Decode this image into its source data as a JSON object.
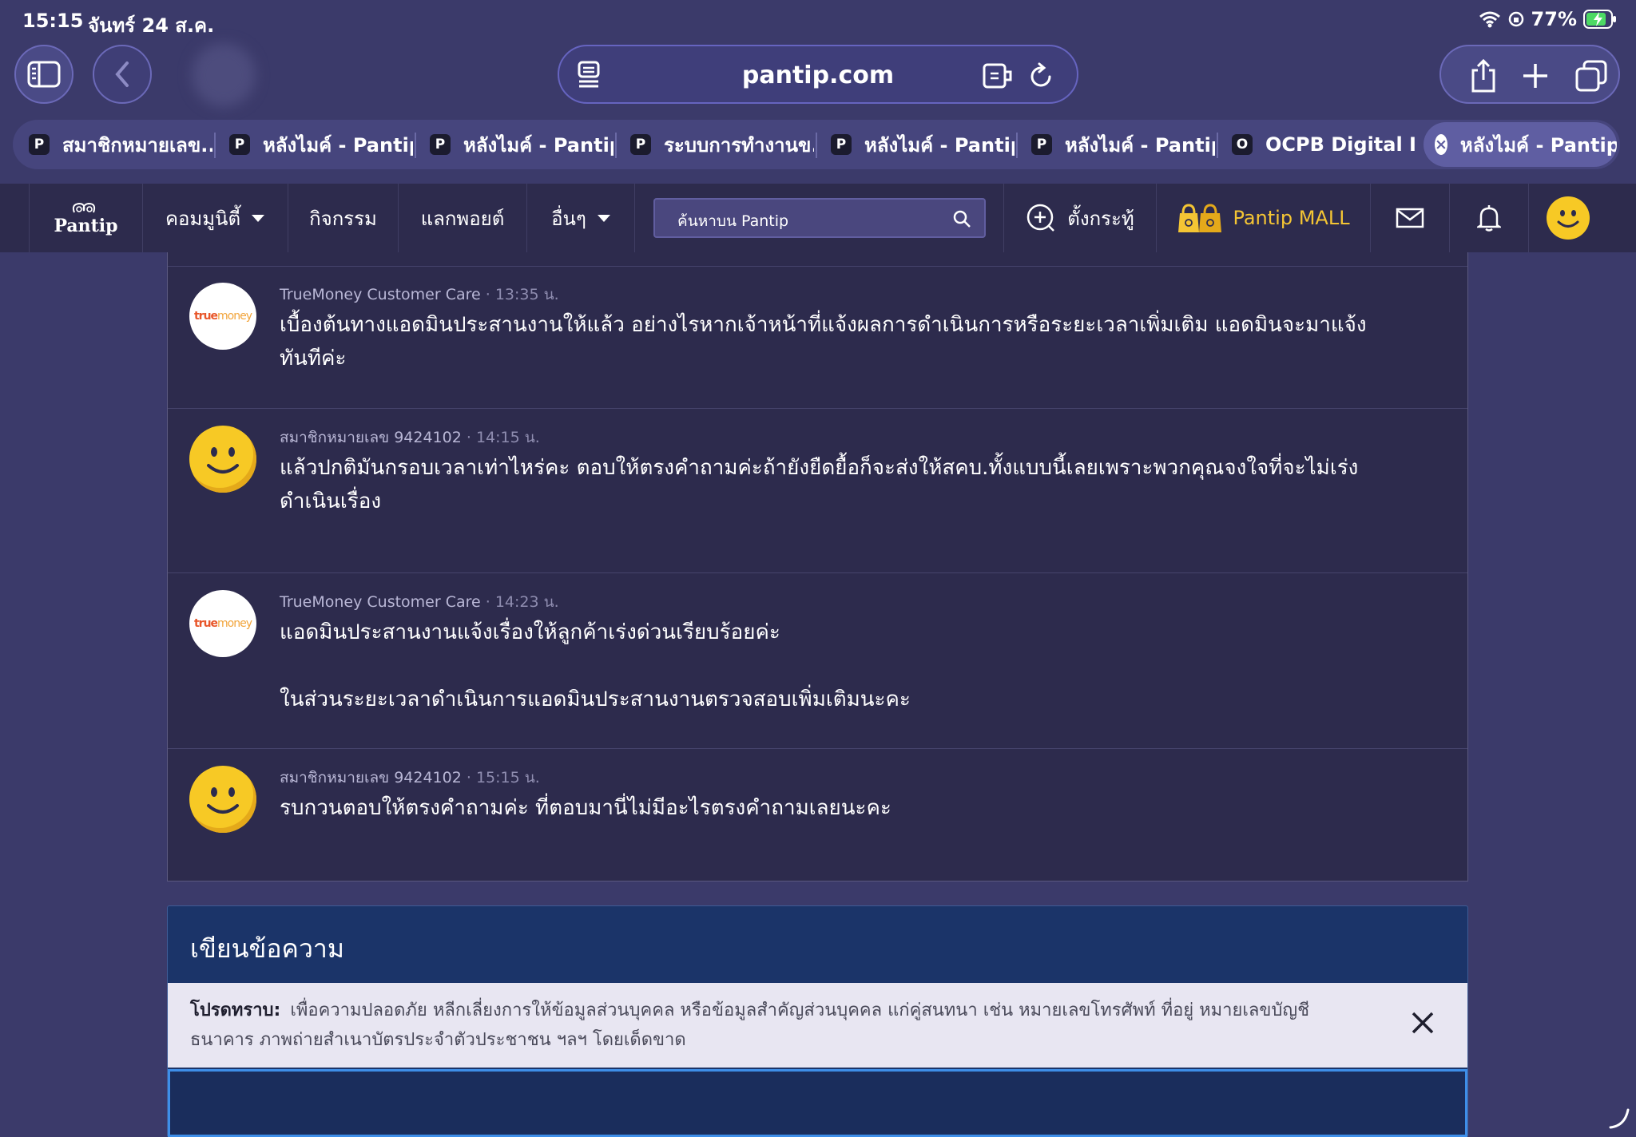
{
  "status": {
    "time": "15:15",
    "date": "จันทร์ 24 ส.ค.",
    "battery": "77%"
  },
  "browser": {
    "url": "pantip.com",
    "tabs": [
      {
        "favicon": "P",
        "label": "สมาชิกหมายเลข..."
      },
      {
        "favicon": "P",
        "label": "หลังไมค์ - Pantip"
      },
      {
        "favicon": "P",
        "label": "หลังไมค์ - Pantip"
      },
      {
        "favicon": "P",
        "label": "ระบบการทำงานข..."
      },
      {
        "favicon": "P",
        "label": "หลังไมค์ - Pantip"
      },
      {
        "favicon": "P",
        "label": "หลังไมค์ - Pantip"
      },
      {
        "favicon": "O",
        "label": "OCPB Digital ID"
      },
      {
        "favicon": "close",
        "label": "หลังไมค์ - Pantip",
        "active": true
      }
    ]
  },
  "nav": {
    "logo": "Pantip",
    "community": "คอมมูนิตี้",
    "activity": "กิจกรรม",
    "points": "แลกพอยต์",
    "more": "อื่นๆ",
    "search_placeholder": "ค้นหาบน Pantip",
    "new_topic": "ตั้งกระทู้",
    "mall": "Pantip MALL"
  },
  "comments": [
    {
      "author": "TrueMoney Customer Care",
      "time": "· 13:35 น.",
      "avatar": "truemoney",
      "lines": [
        "เบื้องต้นทางแอดมินประสานงานให้แล้ว อย่างไรหากเจ้าหน้าที่แจ้งผลการดำเนินการหรือระยะเวลาเพิ่มเติม แอดมินจะมาแจ้ง",
        "ทันทีค่ะ"
      ]
    },
    {
      "author": "สมาชิกหมายเลข 9424102",
      "time": "· 14:15 น.",
      "avatar": "smiley",
      "lines": [
        "แล้วปกติมันกรอบเวลาเท่าไหร่คะ ตอบให้ตรงคำถามค่ะถ้ายังยืดยื้อก็จะส่งให้สคบ.ทั้งแบบนี้เลยเพราะพวกคุณจงใจที่จะไม่เร่ง",
        "ดำเนินเรื่อง"
      ]
    },
    {
      "author": "TrueMoney Customer Care",
      "time": "· 14:23 น.",
      "avatar": "truemoney",
      "lines": [
        "แอดมินประสานงานแจ้งเรื่องให้ลูกค้าเร่งด่วนเรียบร้อยค่ะ",
        "",
        "ในส่วนระยะเวลาดำเนินการแอดมินประสานงานตรวจสอบเพิ่มเติมนะคะ"
      ]
    },
    {
      "author": "สมาชิกหมายเลข 9424102",
      "time": "· 15:15 น.",
      "avatar": "smiley",
      "lines": [
        "รบกวนตอบให้ตรงคำถามค่ะ ที่ตอบมานี่ไม่มีอะไรตรงคำถามเลยนะคะ"
      ]
    }
  ],
  "composer": {
    "title": "เขียนข้อความ",
    "notice_label": "โปรดทราบ:",
    "notice_line1": "เพื่อความปลอดภัย หลีกเลี่ยงการให้ข้อมูลส่วนบุคคล หรือข้อมูลสำคัญส่วนบุคคล แก่คู่สนทนา เช่น หมายเลขโทรศัพท์ ที่อยู่ หมายเลขบัญชี",
    "notice_line2": "ธนาคาร ภาพถ่ายสำเนาบัตรประจำตัวประชาชน ฯลฯ โดยเด็ดขาด"
  },
  "colors": {
    "page_bg": "#3b3a6a",
    "panel_bg": "#2d2b4d",
    "composer_bg": "#1b3469",
    "mall": "#f4c534",
    "focus": "#3e8ee8"
  }
}
